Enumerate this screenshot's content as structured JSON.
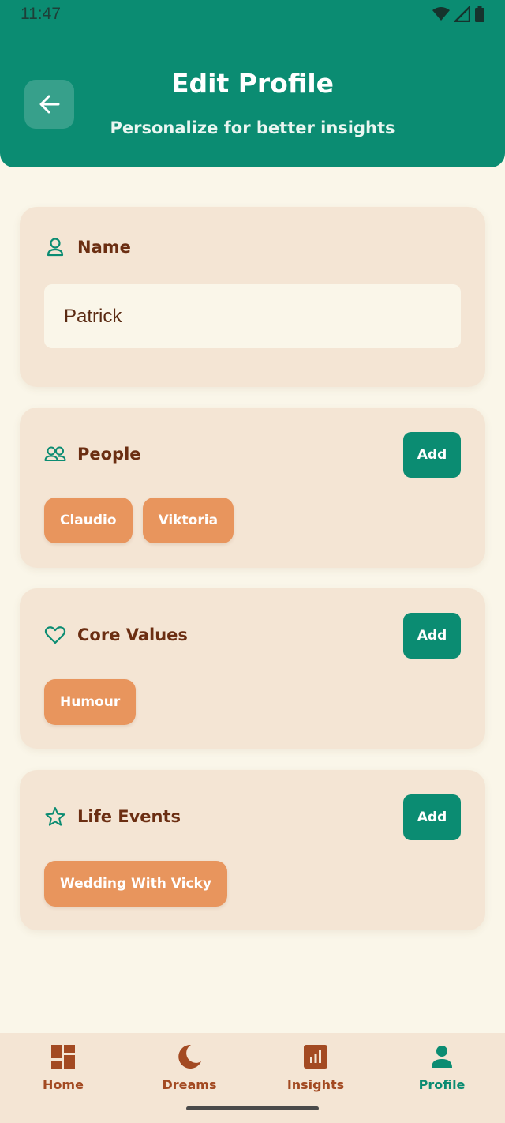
{
  "status_bar": {
    "time": "11:47"
  },
  "header": {
    "title": "Edit Profile",
    "subtitle": "Personalize for better insights",
    "back_icon": "arrow-left-icon"
  },
  "name_section": {
    "title": "Name",
    "icon": "person-icon",
    "input_value": "Patrick"
  },
  "people_section": {
    "title": "People",
    "icon": "people-icon",
    "add_label": "Add",
    "chips": [
      "Claudio",
      "Viktoria"
    ]
  },
  "values_section": {
    "title": "Core Values",
    "icon": "heart-icon",
    "add_label": "Add",
    "chips": [
      "Humour"
    ]
  },
  "events_section": {
    "title": "Life Events",
    "icon": "star-icon",
    "add_label": "Add",
    "chips": [
      "Wedding With Vicky"
    ]
  },
  "bottom_nav": {
    "items": [
      {
        "label": "Home",
        "icon": "dashboard-icon",
        "active": false
      },
      {
        "label": "Dreams",
        "icon": "moon-icon",
        "active": false
      },
      {
        "label": "Insights",
        "icon": "bar-chart-icon",
        "active": false
      },
      {
        "label": "Profile",
        "icon": "person-icon",
        "active": true
      }
    ]
  },
  "colors": {
    "primary": "#0B8C72",
    "background": "#FAF6E9",
    "card": "#F4E5D4",
    "chip": "#E8955D",
    "text": "#6B2E12",
    "nav_inactive": "#A34A22"
  }
}
